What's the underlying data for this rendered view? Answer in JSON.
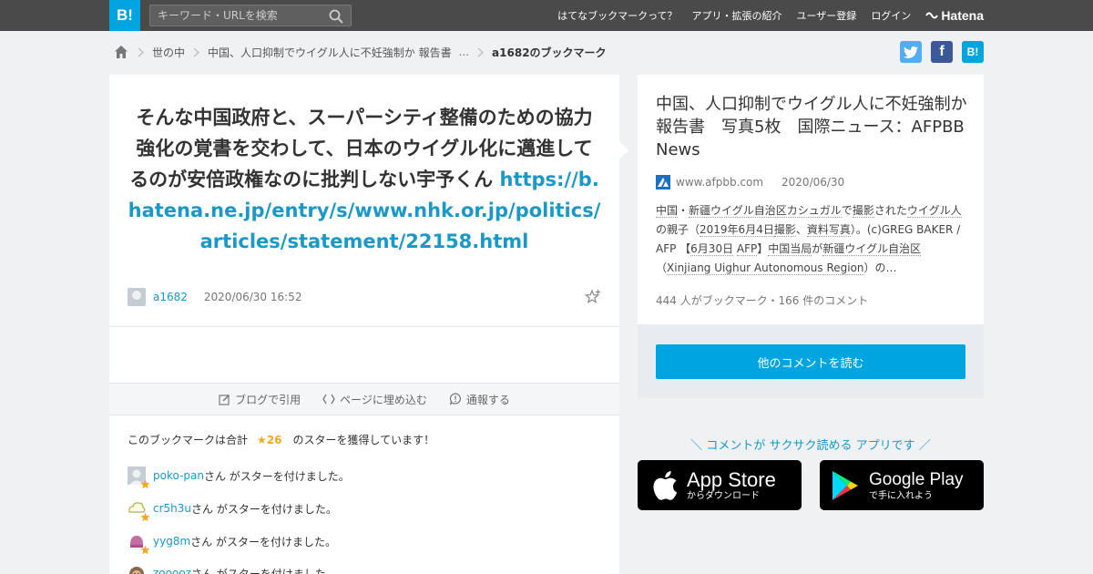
{
  "header": {
    "logo": "B!",
    "search_placeholder": "キーワード・URLを検索",
    "nav": [
      "はてなブックマークって？",
      "アプリ・拡張の紹介",
      "ユーザー登録",
      "ログイン"
    ],
    "brand": "Hatena"
  },
  "breadcrumb": {
    "category": "世の中",
    "entry": "中国、人口抑制でウイグル人に不妊強制か 報告書",
    "ellipsis": "...",
    "current": "a1682のブックマーク"
  },
  "share": {
    "hatena": "B!",
    "facebook": "f"
  },
  "bookmark": {
    "comment": "そんな中国政府と、スーパーシティ整備のための協力強化の覚書を交わして、日本のウイグル化に邁進してるのが安倍政権なのに批判しない宇予くん",
    "link": "https://b.hatena.ne.jp/entry/s/www.nhk.or.jp/politics/articles/statement/22158.html",
    "user": "a1682",
    "datetime": "2020/06/30 16:52"
  },
  "toolbar": {
    "blog": "ブログで引用",
    "embed": "ページに埋め込む",
    "report": "通報する"
  },
  "stars": {
    "prefix": "このブックマークは合計",
    "count": "★26",
    "suffix": "のスターを獲得しています！",
    "action_text": "さん がスターを付けました。",
    "users": [
      "poko-pan",
      "cr5h3u",
      "yyg8m",
      "zooooz"
    ]
  },
  "entry": {
    "title": "中国、人口抑制でウイグル人に不妊強制か 報告書　写真5枚　国際ニュース：AFPBB News",
    "domain": "www.afpbb.com",
    "date": "2020/06/30",
    "desc": {
      "kw1": "中国",
      "t1": "・",
      "kw2": "新疆ウイグル自治区カシュガル",
      "t2": "で",
      "kw3": "撮影",
      "t3": "された",
      "kw4": "ウイグル人",
      "t4": "の親子（",
      "kw5": "2019年6月4日",
      "kw6": "撮影",
      "t5": "、",
      "kw7": "資料写真",
      "t6": "）。(c)GREG BAKER / AFP 【",
      "kw8": "6月30日",
      "t7": " ",
      "kw9": "AFP",
      "t8": "】",
      "kw10": "中国当局",
      "t9": "が",
      "kw11": "新疆ウイグル自治区",
      "t10": "（",
      "kw12": "Xinjiang Uighur Autonomous Region",
      "t11": "）の…"
    },
    "counts": "444 人がブックマーク・166 件のコメント",
    "read_more": "他のコメントを読む"
  },
  "apps": {
    "tagline": "＼ コメントが サクサク読める アプリです ／",
    "appstore_big": "App Store",
    "appstore_small": "からダウンロード",
    "gplay_big": "Google Play",
    "gplay_small": "で手に入れよう"
  },
  "colors": {
    "accent": "#00a4de",
    "link": "#1a98c7",
    "star": "#f5a623",
    "topbar": "#4a4a4a"
  }
}
